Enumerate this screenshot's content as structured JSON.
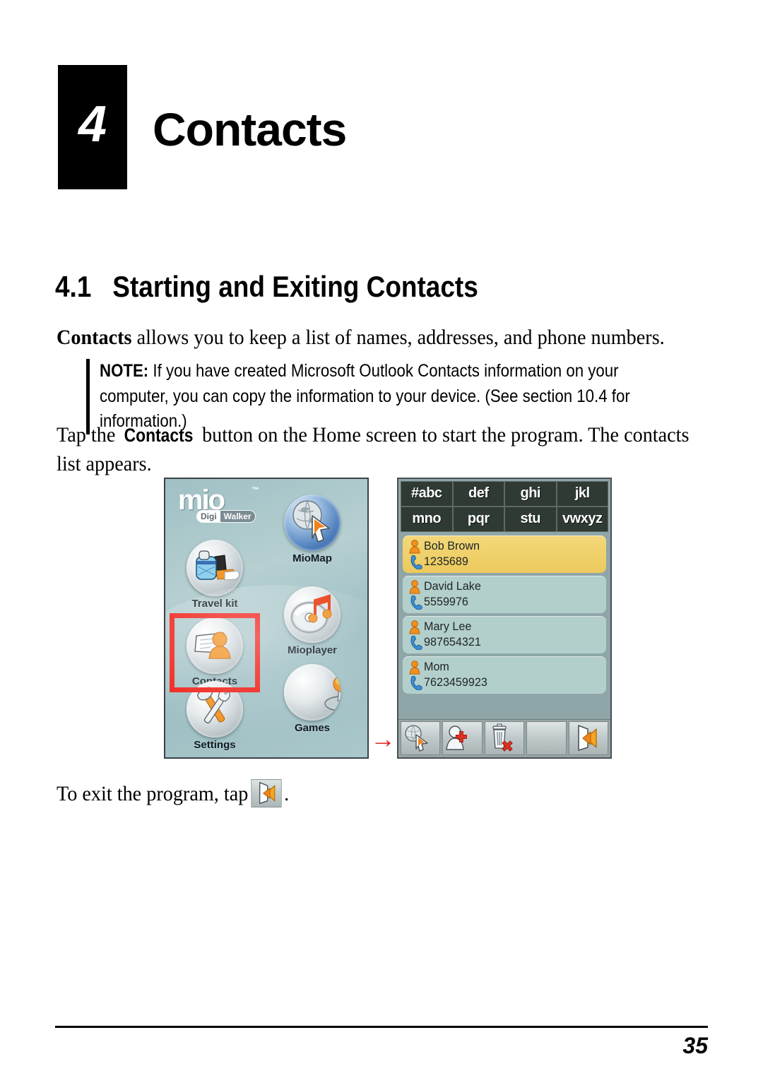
{
  "chapter": {
    "number": "4",
    "title": "Contacts"
  },
  "section": {
    "number": "4.1",
    "title": "Starting and Exiting Contacts"
  },
  "paragraphs": {
    "intro_bold": "Contacts",
    "intro_rest": " allows you to keep a list of names, addresses, and phone numbers.",
    "tap_before": "Tap the ",
    "tap_bold": "Contacts",
    "tap_after": " button on the Home screen to start the program. The contacts list appears.",
    "exit_before": "To exit the program, tap",
    "exit_after": "."
  },
  "note": {
    "label": "NOTE:",
    "text": " If you have created Microsoft Outlook Contacts information on your computer, you can copy the information to your device. (See section 10.4 for information.)"
  },
  "figure": {
    "flow_arrow": "→",
    "home_screen": {
      "logo": {
        "wordmark": "mio",
        "tm": "™",
        "badge_left": "Digi",
        "badge_right": "Walker"
      },
      "apps": [
        {
          "label": "Travel kit",
          "icon": "backpack-icon"
        },
        {
          "label": "MioMap",
          "icon": "globe-arrow-icon"
        },
        {
          "label": "Contacts",
          "icon": "contacts-icon"
        },
        {
          "label": "Mioplayer",
          "icon": "cd-music-icon"
        },
        {
          "label": "Settings",
          "icon": "tools-icon"
        },
        {
          "label": "Games",
          "icon": "joystick-icon"
        }
      ],
      "highlight_target": "Contacts"
    },
    "contacts_screen": {
      "alpha_keys_row1": [
        "#abc",
        "def",
        "ghi",
        "jkl"
      ],
      "alpha_keys_row2": [
        "mno",
        "pqr",
        "stu",
        "vwxyz"
      ],
      "contacts": [
        {
          "name": "Bob Brown",
          "phone": "1235689",
          "selected": true
        },
        {
          "name": "David Lake",
          "phone": "5559976",
          "selected": false
        },
        {
          "name": "Mary Lee",
          "phone": "987654321",
          "selected": false
        },
        {
          "name": "Mom",
          "phone": "7623459923",
          "selected": false
        }
      ],
      "toolbar": [
        {
          "icon": "navigate-map-icon",
          "label": "Navigate"
        },
        {
          "icon": "add-contact-icon",
          "label": "Add contact"
        },
        {
          "icon": "delete-contact-icon",
          "label": "Delete"
        },
        {
          "icon": "blank-icon",
          "label": ""
        },
        {
          "icon": "exit-icon",
          "label": "Exit"
        }
      ]
    }
  },
  "footer": {
    "page_number": "35"
  },
  "colors": {
    "highlight_red": "#ef1c14",
    "selected_row": "#ecc95c",
    "row_background": "#b3cfcb",
    "alpha_key": "#2f3a34",
    "person_orange": "#f08a1e",
    "phone_blue": "#3c8fd6"
  }
}
